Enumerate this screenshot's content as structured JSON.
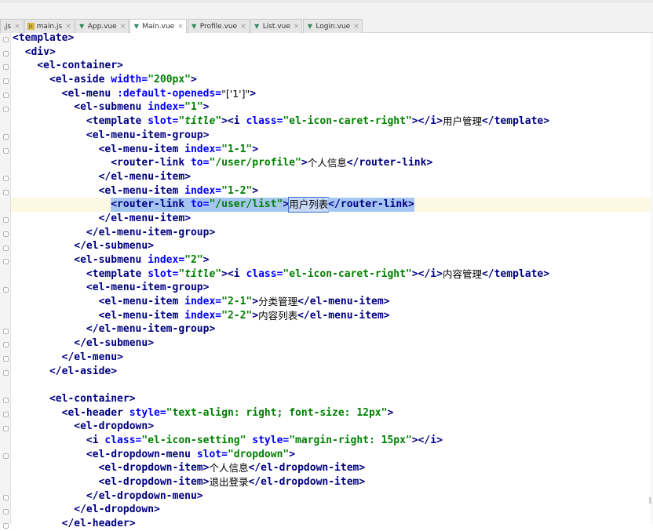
{
  "tabs": [
    {
      "label": ".js",
      "icon": "js-icon",
      "active": false
    },
    {
      "label": "main.js",
      "icon": "js-icon",
      "active": false
    },
    {
      "label": "App.vue",
      "icon": "vue-icon",
      "active": false
    },
    {
      "label": "Main.vue",
      "icon": "vue-icon",
      "active": true
    },
    {
      "label": "Profile.vue",
      "icon": "vue-icon",
      "active": false
    },
    {
      "label": "List.vue",
      "icon": "vue-icon",
      "active": false
    },
    {
      "label": "Login.vue",
      "icon": "vue-icon",
      "active": false
    }
  ],
  "code_lines": [
    [
      [
        "t",
        "<template>"
      ]
    ],
    [
      [
        "p",
        "  "
      ],
      [
        "t",
        "<div>"
      ]
    ],
    [
      [
        "p",
        "    "
      ],
      [
        "t",
        "<el-container>"
      ]
    ],
    [
      [
        "p",
        "      "
      ],
      [
        "t",
        "<el-aside "
      ],
      [
        "a",
        "width="
      ],
      [
        "v",
        "\"200px\""
      ],
      [
        "t",
        ">"
      ]
    ],
    [
      [
        "p",
        "        "
      ],
      [
        "t",
        "<el-menu "
      ],
      [
        "a",
        ":default-openeds="
      ],
      [
        "x",
        "\"['1']\""
      ],
      [
        "t",
        ">"
      ]
    ],
    [
      [
        "p",
        "          "
      ],
      [
        "t",
        "<el-submenu "
      ],
      [
        "a",
        "index="
      ],
      [
        "v",
        "\"1\""
      ],
      [
        "t",
        ">"
      ]
    ],
    [
      [
        "p",
        "            "
      ],
      [
        "t",
        "<template "
      ],
      [
        "a",
        "slot="
      ],
      [
        "v",
        "\""
      ],
      [
        "i",
        "title"
      ],
      [
        "v",
        "\""
      ],
      [
        "t",
        "><i "
      ],
      [
        "a",
        "class="
      ],
      [
        "v",
        "\"el-icon-caret-right\""
      ],
      [
        "t",
        "></i>"
      ],
      [
        "x",
        "用户管理"
      ],
      [
        "t",
        "</template>"
      ]
    ],
    [
      [
        "p",
        "            "
      ],
      [
        "t",
        "<el-menu-item-group>"
      ]
    ],
    [
      [
        "p",
        "              "
      ],
      [
        "t",
        "<el-menu-item "
      ],
      [
        "a",
        "index="
      ],
      [
        "v",
        "\"1-1\""
      ],
      [
        "t",
        ">"
      ]
    ],
    [
      [
        "p",
        "                "
      ],
      [
        "t",
        "<router-link "
      ],
      [
        "a",
        "to="
      ],
      [
        "v",
        "\"/user/profile\""
      ],
      [
        "t",
        ">"
      ],
      [
        "x",
        "个人信息"
      ],
      [
        "t",
        "</router-link>"
      ]
    ],
    [
      [
        "p",
        "              "
      ],
      [
        "t",
        "</el-menu-item>"
      ]
    ],
    [
      [
        "p",
        "              "
      ],
      [
        "t",
        "<el-menu-item "
      ],
      [
        "a",
        "index="
      ],
      [
        "v",
        "\"1-2\""
      ],
      [
        "t",
        ">"
      ]
    ],
    [
      [
        "p",
        "                "
      ],
      [
        "ts",
        "<router-link "
      ],
      [
        "as",
        "to="
      ],
      [
        "vs",
        "\"/user/list\""
      ],
      [
        "ts",
        ">"
      ],
      [
        "xb",
        "用户列表"
      ],
      [
        "ts",
        "</router-link>"
      ]
    ],
    [
      [
        "p",
        "              "
      ],
      [
        "t",
        "</el-menu-item>"
      ]
    ],
    [
      [
        "p",
        "            "
      ],
      [
        "t",
        "</el-menu-item-group>"
      ]
    ],
    [
      [
        "p",
        "          "
      ],
      [
        "t",
        "</el-submenu>"
      ]
    ],
    [
      [
        "p",
        "          "
      ],
      [
        "t",
        "<el-submenu "
      ],
      [
        "a",
        "index="
      ],
      [
        "v",
        "\"2\""
      ],
      [
        "t",
        ">"
      ]
    ],
    [
      [
        "p",
        "            "
      ],
      [
        "t",
        "<template "
      ],
      [
        "a",
        "slot="
      ],
      [
        "v",
        "\""
      ],
      [
        "i",
        "title"
      ],
      [
        "v",
        "\""
      ],
      [
        "t",
        "><i "
      ],
      [
        "a",
        "class="
      ],
      [
        "v",
        "\"el-icon-caret-right\""
      ],
      [
        "t",
        "></i>"
      ],
      [
        "x",
        "内容管理"
      ],
      [
        "t",
        "</template>"
      ]
    ],
    [
      [
        "p",
        "            "
      ],
      [
        "t",
        "<el-menu-item-group>"
      ]
    ],
    [
      [
        "p",
        "              "
      ],
      [
        "t",
        "<el-menu-item "
      ],
      [
        "a",
        "index="
      ],
      [
        "v",
        "\"2-1\""
      ],
      [
        "t",
        ">"
      ],
      [
        "x",
        "分类管理"
      ],
      [
        "t",
        "</el-menu-item>"
      ]
    ],
    [
      [
        "p",
        "              "
      ],
      [
        "t",
        "<el-menu-item "
      ],
      [
        "a",
        "index="
      ],
      [
        "v",
        "\"2-2\""
      ],
      [
        "t",
        ">"
      ],
      [
        "x",
        "内容列表"
      ],
      [
        "t",
        "</el-menu-item>"
      ]
    ],
    [
      [
        "p",
        "            "
      ],
      [
        "t",
        "</el-menu-item-group>"
      ]
    ],
    [
      [
        "p",
        "          "
      ],
      [
        "t",
        "</el-submenu>"
      ]
    ],
    [
      [
        "p",
        "        "
      ],
      [
        "t",
        "</el-menu>"
      ]
    ],
    [
      [
        "p",
        "      "
      ],
      [
        "t",
        "</el-aside>"
      ]
    ],
    [
      [
        "p",
        ""
      ]
    ],
    [
      [
        "p",
        "      "
      ],
      [
        "t",
        "<el-container>"
      ]
    ],
    [
      [
        "p",
        "        "
      ],
      [
        "t",
        "<el-header "
      ],
      [
        "a",
        "style="
      ],
      [
        "v",
        "\"text-align: right; font-size: 12px\""
      ],
      [
        "t",
        ">"
      ]
    ],
    [
      [
        "p",
        "          "
      ],
      [
        "t",
        "<el-dropdown>"
      ]
    ],
    [
      [
        "p",
        "            "
      ],
      [
        "t",
        "<i "
      ],
      [
        "a",
        "class="
      ],
      [
        "v",
        "\"el-icon-setting\" "
      ],
      [
        "a",
        "style="
      ],
      [
        "v",
        "\"margin-right: 15px\""
      ],
      [
        "t",
        "></i>"
      ]
    ],
    [
      [
        "p",
        "            "
      ],
      [
        "t",
        "<el-dropdown-menu "
      ],
      [
        "a",
        "slot="
      ],
      [
        "v",
        "\"dropdown\""
      ],
      [
        "t",
        ">"
      ]
    ],
    [
      [
        "p",
        "              "
      ],
      [
        "t",
        "<el-dropdown-item>"
      ],
      [
        "x",
        "个人信息"
      ],
      [
        "t",
        "</el-dropdown-item>"
      ]
    ],
    [
      [
        "p",
        "              "
      ],
      [
        "t",
        "<el-dropdown-item>"
      ],
      [
        "x",
        "退出登录"
      ],
      [
        "t",
        "</el-dropdown-item>"
      ]
    ],
    [
      [
        "p",
        "            "
      ],
      [
        "t",
        "</el-dropdown-menu>"
      ]
    ],
    [
      [
        "p",
        "          "
      ],
      [
        "t",
        "</el-dropdown>"
      ]
    ],
    [
      [
        "p",
        "        "
      ],
      [
        "t",
        "</el-header>"
      ]
    ]
  ],
  "colors": {
    "tag": "#000080",
    "attribute": "#0000ff",
    "string": "#008000",
    "selection": "#a6c6f2",
    "current_line": "#fcf8e2"
  }
}
